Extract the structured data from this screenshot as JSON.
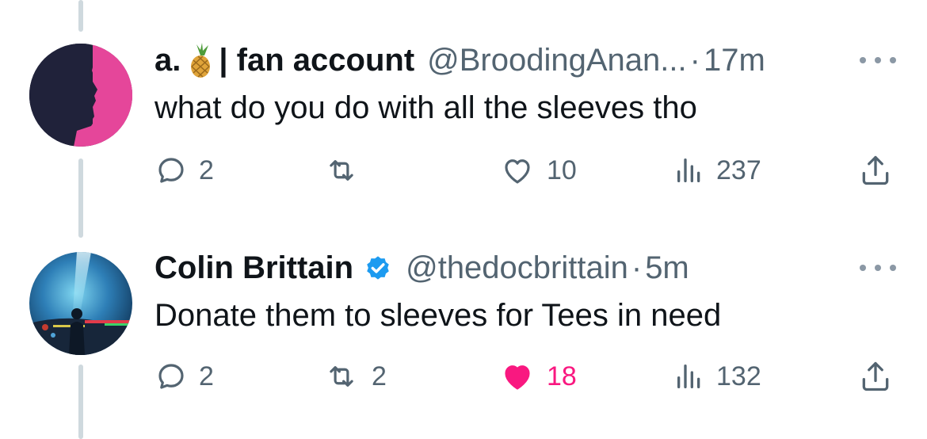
{
  "tweets": [
    {
      "name": "a.",
      "name_suffix": "| fan account",
      "handle": "@BroodingAnan...",
      "separator": "·",
      "time": "17m",
      "text": "what do you do with all the sleeves tho",
      "replies": "2",
      "reposts": "",
      "likes": "10",
      "views": "237",
      "liked": false,
      "verified": false
    },
    {
      "name": "Colin Brittain",
      "handle": "@thedocbrittain",
      "separator": "·",
      "time": "5m",
      "text": "Donate them to sleeves for Tees in need",
      "replies": "2",
      "reposts": "2",
      "likes": "18",
      "views": "132",
      "liked": true,
      "verified": true
    }
  ],
  "icons": {
    "reply": "reply-icon",
    "repost": "repost-icon",
    "like": "heart-icon",
    "views": "views-icon",
    "share": "share-icon",
    "more": "more-icon",
    "verified": "verified-badge-icon",
    "pineapple": "pineapple-emoji-icon"
  },
  "colors": {
    "text": "#0f1419",
    "secondary": "#536471",
    "like": "#f91880",
    "verified": "#1d9bf0",
    "thread_line": "#cfd9de"
  }
}
